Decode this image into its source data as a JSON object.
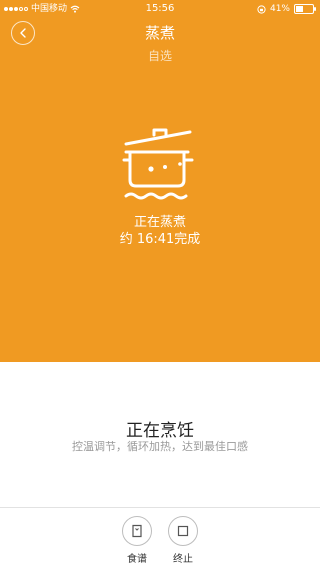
{
  "status_bar": {
    "carrier": "中国移动",
    "time": "15:56",
    "battery": "41%",
    "battery_level": 0.41
  },
  "header": {
    "title": "蒸煮",
    "subtitle": "自选"
  },
  "cooking": {
    "status": "正在蒸煮",
    "eta": "约 16:41完成"
  },
  "info": {
    "title": "正在烹饪",
    "description": "控温调节，循环加热，达到最佳口感"
  },
  "tabs": [
    {
      "label": "食谱",
      "icon": "recipe-icon"
    },
    {
      "label": "终止",
      "icon": "stop-icon"
    }
  ],
  "colors": {
    "accent": "#F09A22",
    "background": "#FFFFFF"
  }
}
